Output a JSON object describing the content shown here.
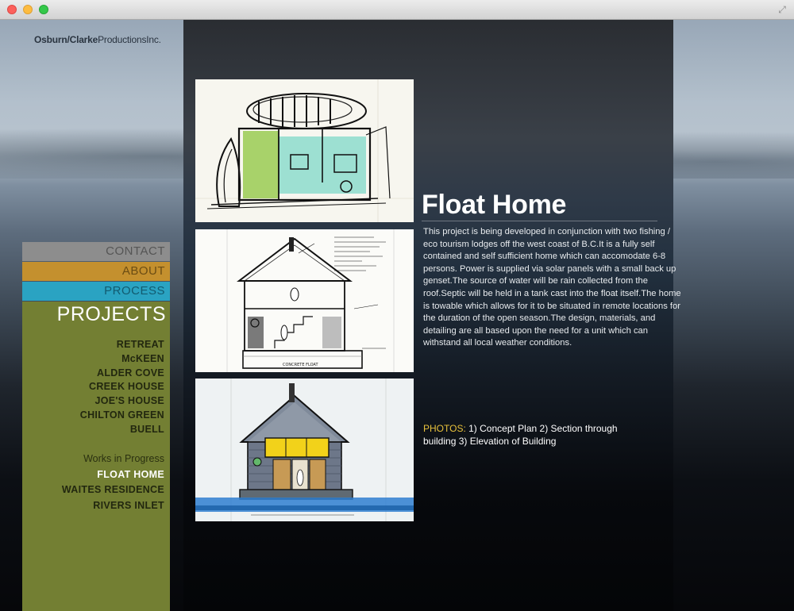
{
  "logo": {
    "part1": "Osburn/Clarke",
    "part2": "ProductionsInc."
  },
  "nav": {
    "contact": "CONTACT",
    "about": "ABOUT",
    "process": "PROCESS",
    "projects_title": "PROJECTS",
    "projects": [
      "RETREAT",
      "McKEEN",
      "ALDER COVE",
      "CREEK HOUSE",
      "JOE'S HOUSE",
      "CHILTON GREEN",
      "BUELL"
    ],
    "wip_label": "Works in Progress",
    "wip": [
      "FLOAT HOME",
      "WAITES RESIDENCE",
      "RIVERS INLET"
    ]
  },
  "content": {
    "title": "Float Home",
    "description": " This project is being developed in conjunction  with two fishing / eco tourism lodges off the west coast of B.C.It is a fully self contained and self sufficient home which can accomodate 6-8 persons. Power is supplied via solar panels with a small back up genset.The source of water will be rain collected from the roof.Septic will be held in a tank cast into the float itself.The home is towable which allows for it to be situated in remote locations for the duration of the open season.The design, materials, and detailing are all based upon the need for a unit which can withstand all local weather conditions.",
    "photos_label": "PHOTOS:",
    "photos_text": " 1) Concept Plan 2) Section through building 3) Elevation of Building"
  },
  "photo_alts": [
    "Concept Plan",
    "Section through building",
    "Elevation of Building"
  ],
  "colors": {
    "contact": "#8d8d8d",
    "about": "#c4902e",
    "process": "#2aa3c2",
    "projects_panel": "#737f33",
    "photos_label": "#e8c23c"
  }
}
